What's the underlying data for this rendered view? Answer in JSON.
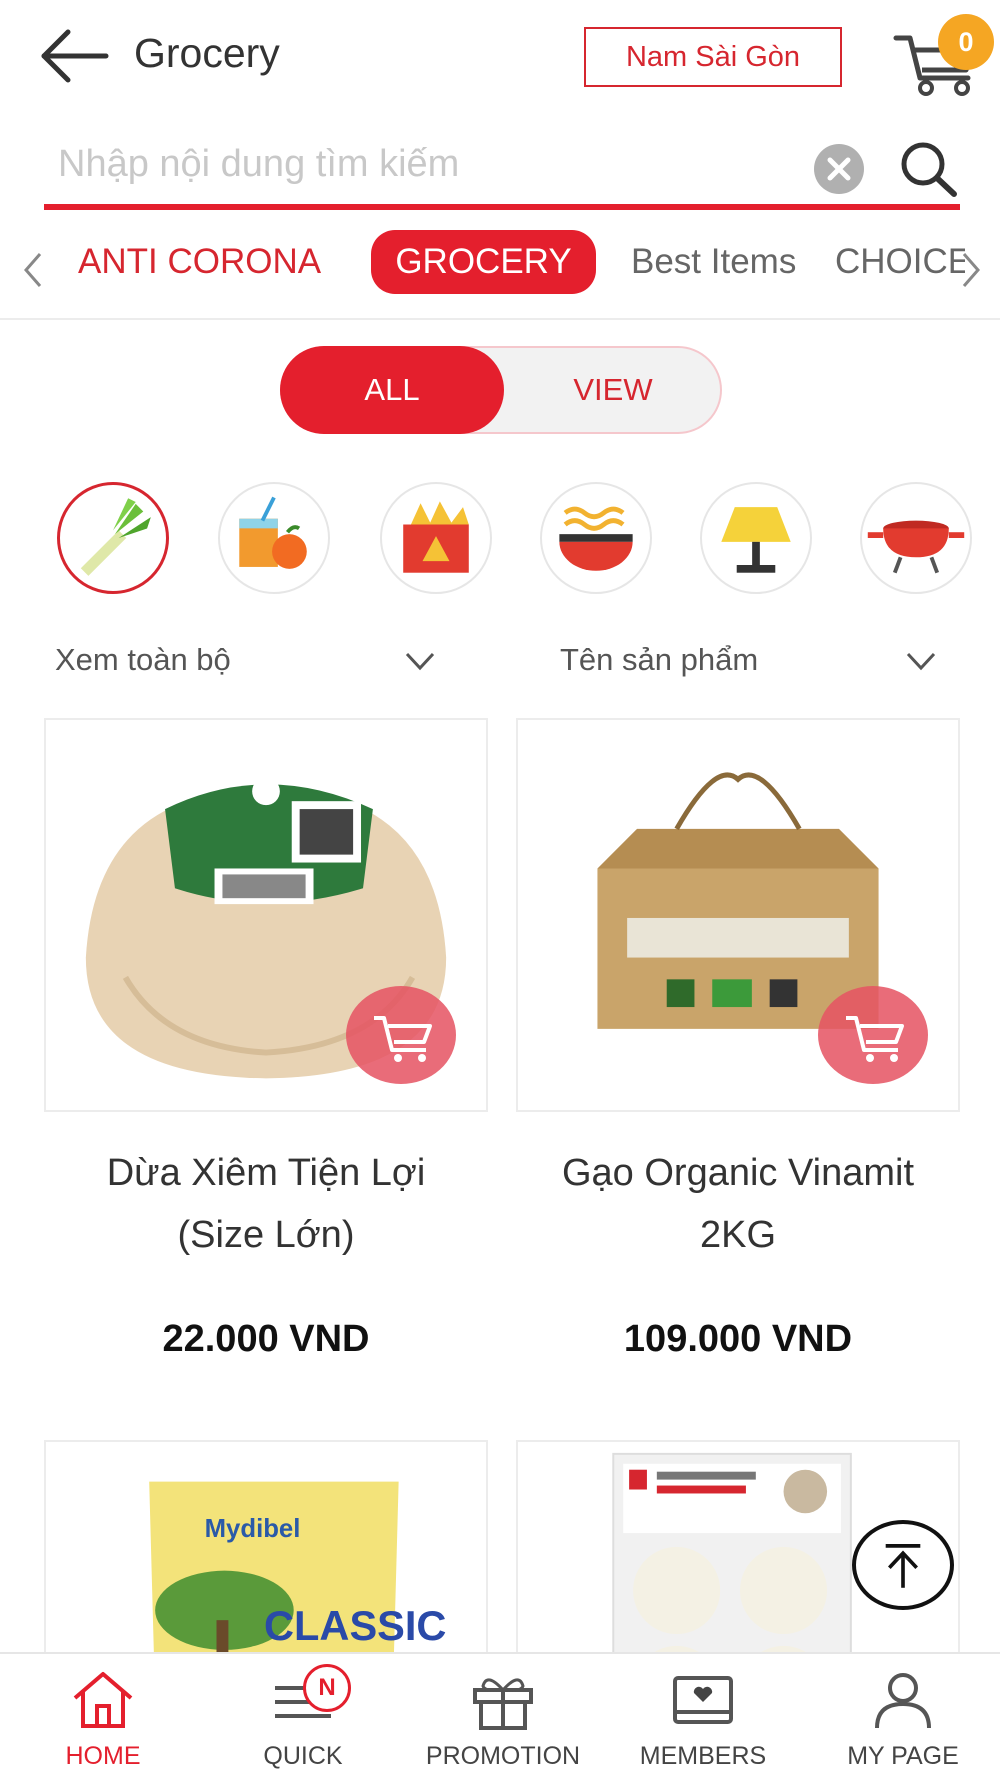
{
  "header": {
    "title": "Grocery",
    "store_label": "Nam Sài Gòn",
    "cart_count": "0"
  },
  "search": {
    "placeholder": "Nhập nội dung tìm kiếm",
    "value": ""
  },
  "category_tabs": [
    {
      "label": "ANTI CORONA",
      "active": false
    },
    {
      "label": "GROCERY",
      "active": true
    },
    {
      "label": "Best Items",
      "active": false
    },
    {
      "label": "CHOICE",
      "active": false
    }
  ],
  "view_toggle": {
    "all_label": "ALL",
    "view_label": "VIEW",
    "selected": "ALL"
  },
  "category_icons": [
    {
      "icon": "leek-icon",
      "active": true
    },
    {
      "icon": "juice-fruit-icon",
      "active": false
    },
    {
      "icon": "snack-box-icon",
      "active": false
    },
    {
      "icon": "noodle-bowl-icon",
      "active": false
    },
    {
      "icon": "lamp-icon",
      "active": false
    },
    {
      "icon": "cooking-pot-icon",
      "active": false
    }
  ],
  "filters": {
    "scope_label": "Xem toàn bộ",
    "sort_label": "Tên sản phẩm"
  },
  "products": [
    {
      "name_line1": "Dừa Xiêm Tiện Lợi",
      "name_line2": "(Size Lớn)",
      "price": "22.000 VND",
      "image": "coconut-image"
    },
    {
      "name_line1": "Gạo Organic Vinamit",
      "name_line2": "2KG",
      "price": "109.000 VND",
      "image": "organic-rice-bag-image"
    },
    {
      "name_line1": "",
      "name_line2": "",
      "price": "",
      "image": "mydibel-classic-fries-image"
    },
    {
      "name_line1": "",
      "name_line2": "",
      "price": "",
      "image": "steamed-buns-pack-image"
    }
  ],
  "bottom_nav": [
    {
      "label": "HOME",
      "icon": "home-icon",
      "active": true
    },
    {
      "label": "QUICK",
      "icon": "quick-menu-icon",
      "badge": "N",
      "active": false
    },
    {
      "label": "PROMOTION",
      "icon": "gift-icon",
      "active": false
    },
    {
      "label": "MEMBERS",
      "icon": "member-card-icon",
      "active": false
    },
    {
      "label": "MY PAGE",
      "icon": "user-icon",
      "active": false
    }
  ],
  "colors": {
    "brand_red": "#e41f2d",
    "badge_orange": "#f5a623",
    "text_dark": "#333333"
  }
}
